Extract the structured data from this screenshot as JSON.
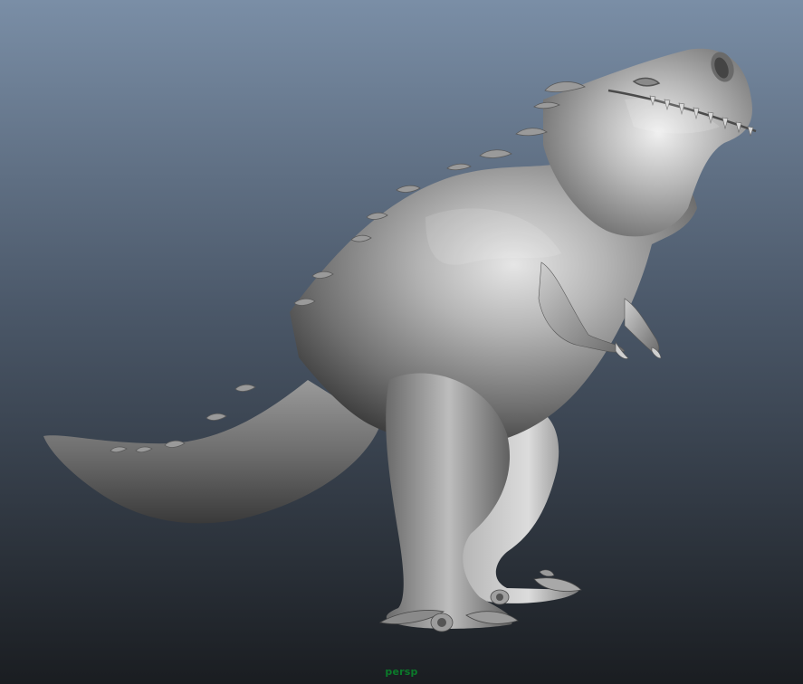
{
  "viewport": {
    "camera_name": "persp",
    "camera_label_color": "#0b7a2a",
    "background_top_color": "#7a8ea6",
    "background_bottom_color": "#1a1d21"
  },
  "model": {
    "name": "t-rex-sculpt",
    "shading": "smooth-shaded",
    "base_color": "#8c8c8c",
    "highlight_color": "#e8e8e8",
    "shadow_color": "#3c3c3c"
  }
}
